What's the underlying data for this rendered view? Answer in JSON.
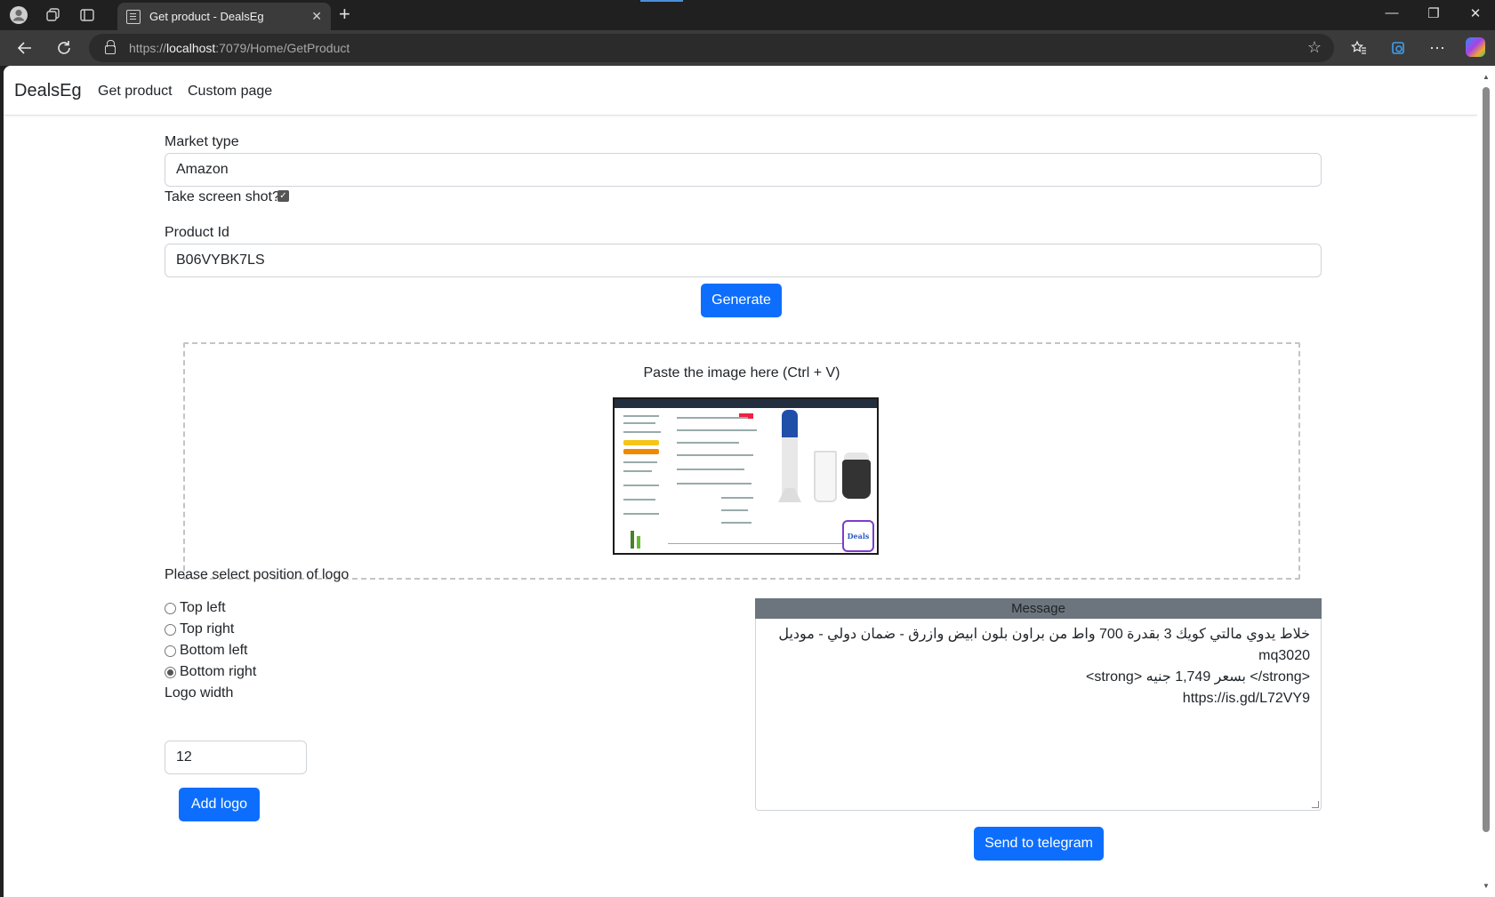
{
  "browser": {
    "tab_title": "Get product - DealsEg",
    "url_scheme": "https://",
    "url_host": "localhost",
    "url_rest": ":7079/Home/GetProduct"
  },
  "nav": {
    "brand": "DealsEg",
    "links": [
      "Get product",
      "Custom page"
    ]
  },
  "form": {
    "market_type_label": "Market type",
    "market_type_value": "Amazon",
    "screenshot_label": "Take screen shot?",
    "screenshot_checked": true,
    "product_id_label": "Product Id",
    "product_id_value": "B06VYBK7LS",
    "generate_label": "Generate"
  },
  "dropzone": {
    "text": "Paste the image here (Ctrl + V)",
    "logo_text": "Deals"
  },
  "logo": {
    "position_label": "Please select position of logo",
    "options": [
      "Top left",
      "Top right",
      "Bottom left",
      "Bottom right"
    ],
    "selected": "Bottom right",
    "width_label": "Logo width",
    "width_value": "12",
    "add_label": "Add logo"
  },
  "message": {
    "header": "Message",
    "lines": [
      "خلاط يدوي مالتي كويك 3 بقدرة 700 واط من براون بلون ابيض وازرق - ضمان دولي - موديل mq3020",
      "<strong> بسعر 1,749 جنيه </strong>",
      "https://is.gd/L72VY9"
    ],
    "send_label": "Send to telegram"
  },
  "colors": {
    "primary": "#0d6efd",
    "message_header": "#6c757d",
    "chrome_dark": "#202020",
    "chrome_toolbar": "#3b3b3b"
  }
}
